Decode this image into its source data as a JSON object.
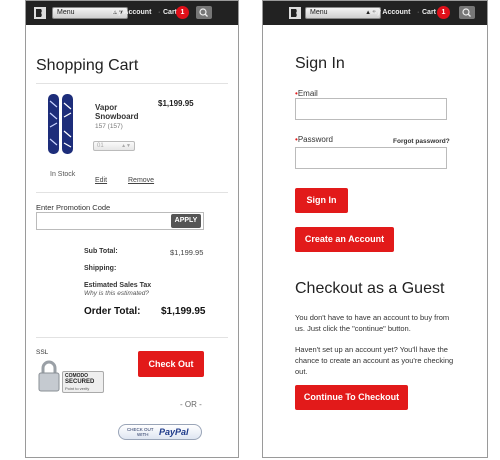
{
  "nav": {
    "menu_label": "Menu",
    "my_account": "My Account",
    "separator": "·",
    "cart": "Cart",
    "cart_count": "1"
  },
  "cart": {
    "title": "Shopping Cart",
    "product_name_line1": "Vapor",
    "product_name_line2": "Snowboard",
    "product_size": "157 (157)",
    "price": "$1,199.95",
    "qty": "01",
    "stock": "In Stock",
    "edit": "Edit",
    "remove": "Remove",
    "promo_label": "Enter Promotion Code",
    "apply": "APPLY",
    "subtotal_label": "Sub Total:",
    "subtotal_value": "$1,199.95",
    "shipping_label": "Shipping:",
    "tax_label": "Estimated Sales Tax",
    "tax_why": "Why is this estimated?",
    "order_total_label": "Order Total:",
    "order_total_value": "$1,199.95",
    "ssl": "SSL",
    "comodo_line1": "COMODO",
    "comodo_line2": "SECURED",
    "comodo_line3": "Point to verify",
    "checkout": "Check Out",
    "or": "- OR -",
    "paypal_small1": "CHECK OUT",
    "paypal_small2": "WITH",
    "paypal_brand": "PayPal"
  },
  "signin": {
    "title": "Sign In",
    "email_label": "Email",
    "password_label": "Password",
    "forgot": "Forgot password?",
    "signin_button": "Sign In",
    "create_account": "Create an Account",
    "guest_title": "Checkout as a Guest",
    "guest_p1": "You don't have to have an account to buy from us. Just click the \"continue\" button.",
    "guest_p2": "Haven't set up an account yet? You'll have the chance to create an account as you're checking out.",
    "continue_checkout": "Continue To Checkout"
  },
  "colors": {
    "accent_red": "#e21a1a",
    "topbar": "#222222"
  }
}
